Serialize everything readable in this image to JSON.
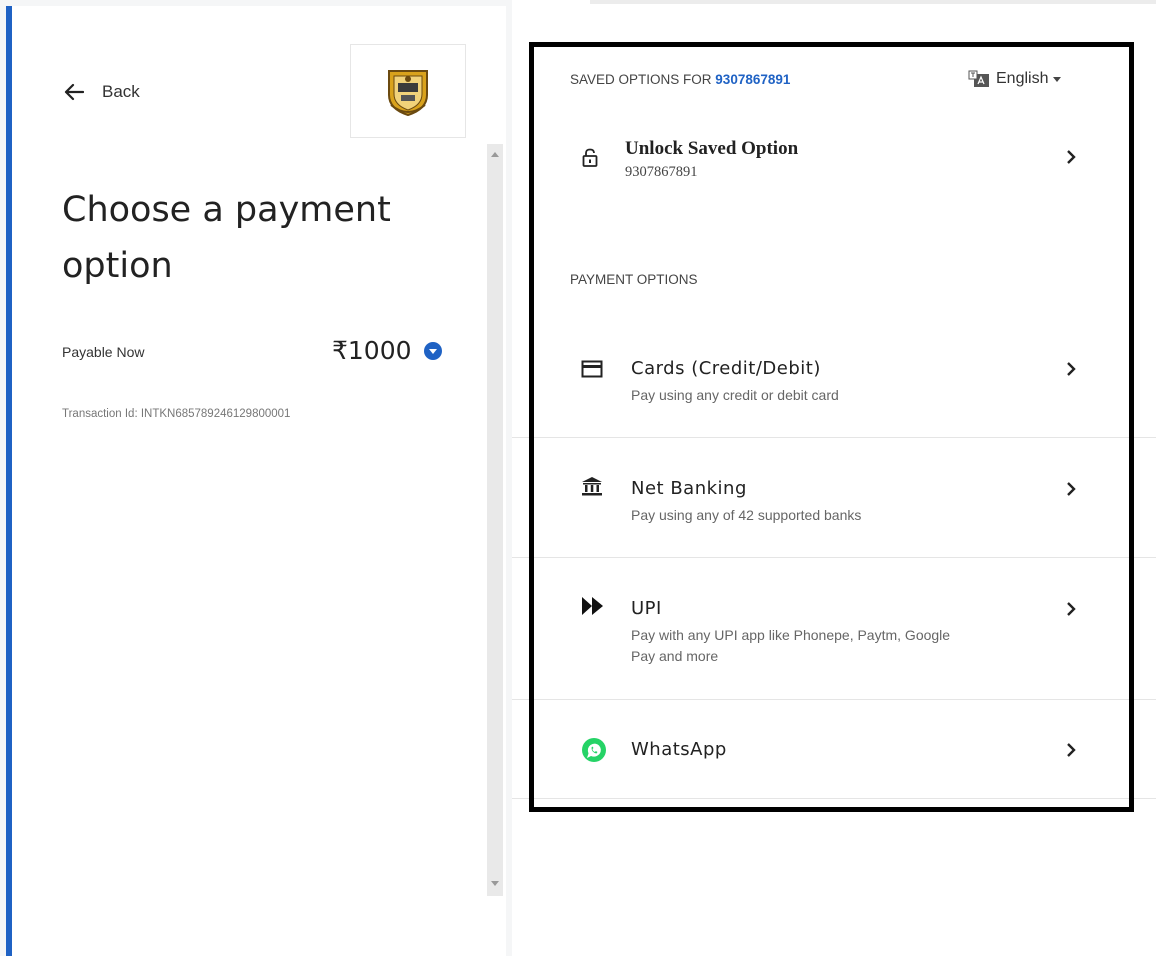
{
  "left": {
    "back_label": "Back",
    "title": "Choose a payment option",
    "payable_label": "Payable Now",
    "amount": "₹1000",
    "transaction": "Transaction Id: INTKN685789246129800001"
  },
  "right": {
    "saved_header_prefix": "SAVED OPTIONS FOR",
    "saved_phone": "9307867891",
    "language": "English",
    "unlock": {
      "title": "Unlock Saved Option",
      "subtitle": "9307867891"
    },
    "payment_options_label": "PAYMENT OPTIONS",
    "options": [
      {
        "title": "Cards (Credit/Debit)",
        "subtitle": "Pay using any credit or debit card",
        "icon": "card-icon"
      },
      {
        "title": "Net Banking",
        "subtitle": "Pay using any of 42 supported banks",
        "icon": "bank-icon"
      },
      {
        "title": "UPI",
        "subtitle": "Pay with any UPI app like Phonepe, Paytm, Google Pay and more",
        "icon": "upi-icon"
      },
      {
        "title": "WhatsApp",
        "subtitle": "",
        "icon": "whatsapp-icon"
      }
    ]
  },
  "colors": {
    "accent": "#1f62c4",
    "whatsapp": "#25d366",
    "highlight_border": "#000000"
  }
}
